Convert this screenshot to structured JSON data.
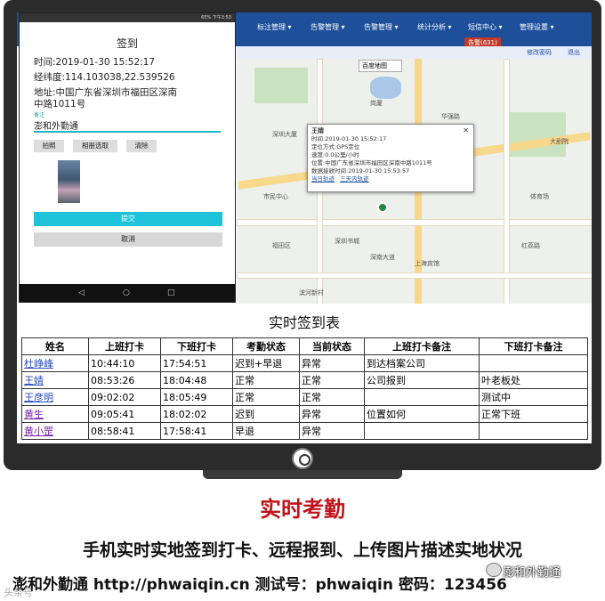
{
  "app_nav": {
    "items": [
      "标注管理 ▾",
      "告警管理 ▾",
      "统计分析 ▾",
      "短信中心 ▾",
      "管理设置 ▾"
    ],
    "alarm_button": "告警(631)",
    "sub_links": [
      "修改密码",
      "退出"
    ],
    "map_type": "百度地图"
  },
  "map": {
    "labels": [
      "岗厦",
      "深圳大厦",
      "华强路",
      "大剧院",
      "市民中心",
      "深圳书城",
      "体育场",
      "福田区",
      "上海宾馆",
      "深南大道",
      "滨河新村",
      "红荔路"
    ],
    "popup": {
      "name": "王婧",
      "time": "时间:2019-01-30 15:52:17",
      "method": "定位方式:GPS定位",
      "speed": "速度:0.0公里/小时",
      "location": "位置:中国广东省深圳市福田区深南中路1011号",
      "received": "数据接收时间:2019-01-30 15:53:57",
      "link_today": "当日轨迹",
      "link_3days": "三天内轨迹"
    }
  },
  "phone": {
    "status_bar": "65% 下午3:53",
    "title": "签到",
    "time": "时间:2019-01-30 15:52:17",
    "coords": "经纬度:114.103038,22.539526",
    "address_line1": "地址:中国广东省深圳市福田区深南",
    "address_line2": "中路1011号",
    "note_label": "备注",
    "note_value": "澎和外勤通",
    "buttons": [
      "拍照",
      "相册选取",
      "清除"
    ],
    "submit": "提交",
    "cancel": "取消"
  },
  "table": {
    "title": "实时签到表",
    "headers": [
      "姓名",
      "上班打卡",
      "下班打卡",
      "考勤状态",
      "当前状态",
      "上班打卡备注",
      "下班打卡备注"
    ],
    "rows": [
      [
        "杜峥峰",
        "10:44:10",
        "17:54:51",
        "迟到+早退",
        "异常",
        "到达档案公司",
        ""
      ],
      [
        "王婧",
        "08:53:26",
        "18:04:48",
        "正常",
        "正常",
        "公司报到",
        "叶老板处"
      ],
      [
        "王彦明",
        "09:02:02",
        "18:05:49",
        "正常",
        "正常",
        "",
        "测试中"
      ],
      [
        "黄生",
        "09:05:41",
        "18:02:02",
        "迟到",
        "异常",
        "位置如何",
        "正常下班"
      ],
      [
        "黄小罡",
        "08:58:41",
        "17:58:41",
        "早退",
        "异常",
        "",
        ""
      ]
    ],
    "name_colors": [
      "#2a4fbf",
      "#2a4fbf",
      "#2a4fbf",
      "#7a1fa8",
      "#7a1fa8"
    ]
  },
  "promo": {
    "title": "实时考勤",
    "line1": "手机实时实地签到打卡、远程报到、上传图片描述实地状况",
    "line2": "澎和外勤通  http://phwaiqin.cn  测试号：phwaiqin 密码：123456",
    "wechat": "澎和外勤通",
    "watermark": "头条号"
  }
}
